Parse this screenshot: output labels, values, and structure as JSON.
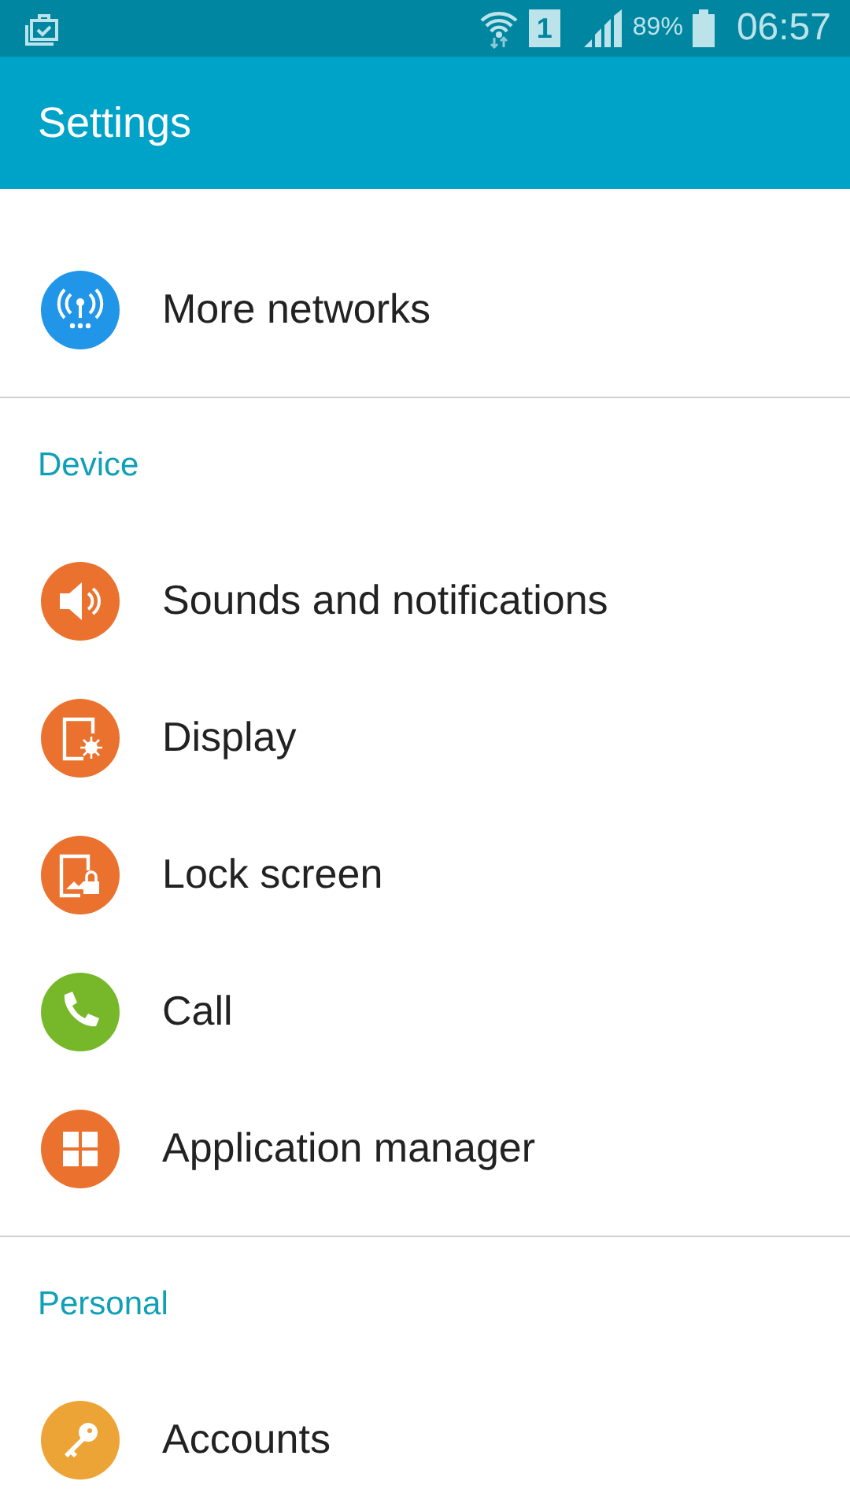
{
  "status_bar": {
    "sim_slot": "1",
    "battery_text": "89%",
    "time": "06:57"
  },
  "app_bar": {
    "title": "Settings"
  },
  "sections": [
    {
      "items": [
        {
          "label": "More networks",
          "kind": "antenna",
          "color": "#2196e8"
        }
      ]
    },
    {
      "header": "Device",
      "items": [
        {
          "label": "Sounds and notifications",
          "kind": "speaker",
          "color": "#ea722e"
        },
        {
          "label": "Display",
          "kind": "display",
          "color": "#ea722e"
        },
        {
          "label": "Lock screen",
          "kind": "lockscreen",
          "color": "#ea722e"
        },
        {
          "label": "Call",
          "kind": "phone",
          "color": "#76b82a"
        },
        {
          "label": "Application manager",
          "kind": "grid",
          "color": "#ea722e"
        }
      ]
    },
    {
      "header": "Personal",
      "items": [
        {
          "label": "Accounts",
          "kind": "key",
          "color": "#eda436"
        }
      ]
    }
  ]
}
